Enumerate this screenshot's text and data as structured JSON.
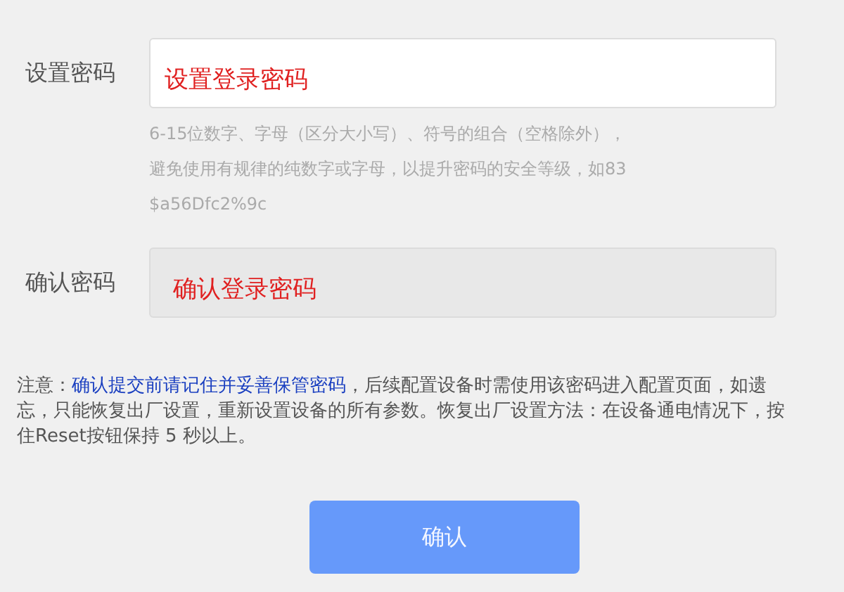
{
  "fields": [
    {
      "label": "设置密码",
      "value": "设置登录密码",
      "disabled": false,
      "hint": [
        "6-15位数字、字母（区分大小写）、符号的组合（空格除外），",
        "避免使用有规律的纯数字或字母，以提升密码的安全等级，如83",
        "$a56Dfc2%9c"
      ]
    },
    {
      "label": "确认密码",
      "value": "确认登录密码",
      "disabled": true
    }
  ],
  "note": {
    "prefix": "注意：",
    "highlight": "确认提交前请记住并妥善保管密码",
    "rest": "，后续配置设备时需使用该密码进入配置页面，如遗忘，只能恢复出厂设置，重新设置设备的所有参数。恢复出厂设置方法：在设备通电情况下，按住Reset按钮保持 5 秒以上。"
  },
  "button": "确认"
}
